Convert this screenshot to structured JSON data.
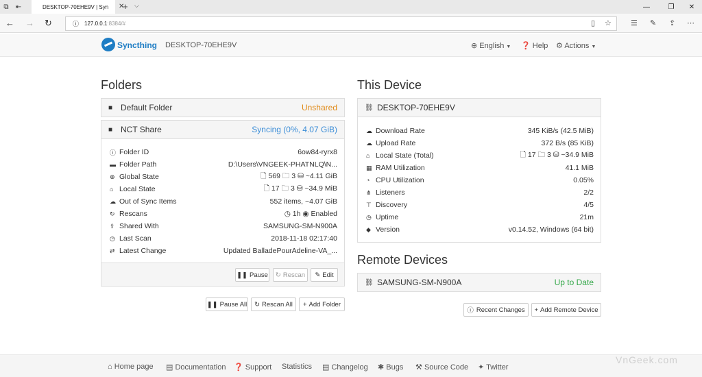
{
  "browser": {
    "tab_title": "DESKTOP-70EHE9V | Syn",
    "url_host": "127.0.0.1",
    "url_rest": ":8384/#"
  },
  "navbar": {
    "brand": "Syncthing",
    "device": "DESKTOP-70EHE9V",
    "language": "English",
    "help": "Help",
    "actions": "Actions"
  },
  "folders": {
    "heading": "Folders",
    "default_folder": {
      "name": "Default Folder",
      "status": "Unshared"
    },
    "nct_share": {
      "name": "NCT Share",
      "status": "Syncing (0%, 4.07 GiB)",
      "rows": [
        {
          "label": "Folder ID",
          "value": "6ow84-ryrx8"
        },
        {
          "label": "Folder Path",
          "value": "D:\\Users\\VNGEEK-PHATNLQ\\N..."
        },
        {
          "label": "Global State",
          "value": "🗋 569  🗀 3  ⛁ ~4.11 GiB"
        },
        {
          "label": "Local State",
          "value": "🗋 17  🗀 3  ⛁ ~34.9 MiB"
        },
        {
          "label": "Out of Sync Items",
          "value": "552 items, ~4.07 GiB"
        },
        {
          "label": "Rescans",
          "value": "◷ 1h  ◉ Enabled"
        },
        {
          "label": "Shared With",
          "value": "SAMSUNG-SM-N900A"
        },
        {
          "label": "Last Scan",
          "value": "2018-11-18 02:17:40"
        },
        {
          "label": "Latest Change",
          "value": "Updated BalladePourAdeline-VA_..."
        }
      ],
      "buttons": {
        "pause": "Pause",
        "rescan": "Rescan",
        "edit": "Edit"
      }
    },
    "actions": {
      "pause_all": "Pause All",
      "rescan_all": "Rescan All",
      "add_folder": "Add Folder"
    }
  },
  "this_device": {
    "heading": "This Device",
    "name": "DESKTOP-70EHE9V",
    "rows": [
      {
        "label": "Download Rate",
        "value": "345 KiB/s (42.5 MiB)"
      },
      {
        "label": "Upload Rate",
        "value": "372 B/s (85 KiB)"
      },
      {
        "label": "Local State (Total)",
        "value": "🗋 17  🗀 3  ⛁ ~34.9 MiB"
      },
      {
        "label": "RAM Utilization",
        "value": "41.1 MiB"
      },
      {
        "label": "CPU Utilization",
        "value": "0.05%"
      },
      {
        "label": "Listeners",
        "value": "2/2"
      },
      {
        "label": "Discovery",
        "value": "4/5"
      },
      {
        "label": "Uptime",
        "value": "21m"
      },
      {
        "label": "Version",
        "value": "v0.14.52, Windows (64 bit)"
      }
    ]
  },
  "remote_devices": {
    "heading": "Remote Devices",
    "device": {
      "name": "SAMSUNG-SM-N900A",
      "status": "Up to Date"
    },
    "actions": {
      "recent_changes": "Recent Changes",
      "add_remote": "Add Remote Device"
    }
  },
  "footer": {
    "home": "Home page",
    "docs": "Documentation",
    "support": "Support",
    "statistics": "Statistics",
    "changelog": "Changelog",
    "bugs": "Bugs",
    "source": "Source Code",
    "twitter": "Twitter"
  },
  "watermark": "VnGeek.com",
  "colors": {
    "brand": "#1e7dc4",
    "unshared": "#e08a18",
    "syncing": "#3b8dd7",
    "up_to_date": "#35a84a"
  }
}
